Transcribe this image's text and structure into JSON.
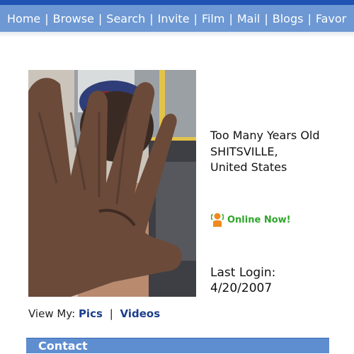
{
  "nav": {
    "items": [
      "Home",
      "Browse",
      "Search",
      "Invite",
      "Film",
      "Mail",
      "Blogs",
      "Favor"
    ],
    "separator": "|"
  },
  "profile": {
    "age_line": "Too Many Years Old",
    "city": "SHITSVILLE,",
    "country": "United States",
    "online_label": "Online Now!",
    "last_login_label": "Last Login:",
    "last_login_date": "4/20/2007"
  },
  "view_my": {
    "label": "View My:",
    "pics": "Pics",
    "separator": "|",
    "videos": "Videos"
  },
  "contact": {
    "title": "Contact"
  },
  "colors": {
    "nav_bg": "#6d98d3",
    "top_strip": "#1f52b3",
    "online_green": "#2fa52b",
    "link_blue": "#1c3e8c",
    "contact_bg": "#5f8ed0"
  }
}
